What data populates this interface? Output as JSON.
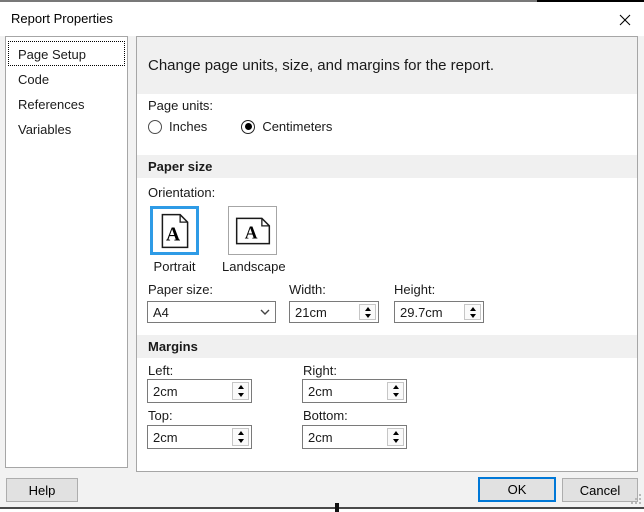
{
  "window": {
    "title": "Report Properties"
  },
  "sidebar": {
    "items": [
      {
        "label": "Page Setup",
        "selected": true
      },
      {
        "label": "Code",
        "selected": false
      },
      {
        "label": "References",
        "selected": false
      },
      {
        "label": "Variables",
        "selected": false
      }
    ]
  },
  "header": {
    "description": "Change page units, size, and margins for the report."
  },
  "page_units": {
    "label": "Page units:",
    "options": [
      {
        "label": "Inches",
        "selected": false
      },
      {
        "label": "Centimeters",
        "selected": true
      }
    ]
  },
  "paper_size_section": {
    "title": "Paper size",
    "orientation_label": "Orientation:",
    "orientations": [
      {
        "label": "Portrait",
        "selected": true,
        "icon_letter": "A"
      },
      {
        "label": "Landscape",
        "selected": false,
        "icon_letter": "A"
      }
    ],
    "paper_size_label": "Paper size:",
    "paper_size_value": "A4",
    "width_label": "Width:",
    "width_value": "21cm",
    "height_label": "Height:",
    "height_value": "29.7cm"
  },
  "margins_section": {
    "title": "Margins",
    "fields": [
      {
        "label": "Left:",
        "value": "2cm"
      },
      {
        "label": "Right:",
        "value": "2cm"
      },
      {
        "label": "Top:",
        "value": "2cm"
      },
      {
        "label": "Bottom:",
        "value": "2cm"
      }
    ]
  },
  "footer": {
    "help_label": "Help",
    "ok_label": "OK",
    "cancel_label": "Cancel"
  },
  "colors": {
    "accent_blue": "#0078d7",
    "tile_selected_border": "#2e9be6",
    "band_gray": "#f0f0f0"
  }
}
